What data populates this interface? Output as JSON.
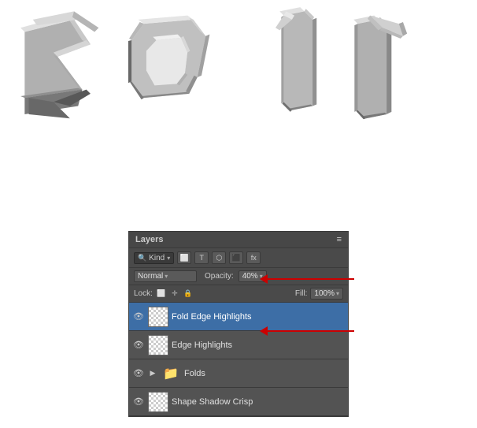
{
  "panel": {
    "title": "Layers",
    "menu_icon": "≡",
    "filter": {
      "kind_label": "Kind",
      "kind_arrow": "▾"
    },
    "blend_mode": {
      "label": "Normal",
      "arrow": "▾"
    },
    "opacity": {
      "label": "Opacity:",
      "value": "40%",
      "arrow": "▾"
    },
    "lock": {
      "label": "Lock:"
    },
    "fill": {
      "label": "Fill:",
      "value": "100%",
      "arrow": "▾"
    },
    "layers": [
      {
        "name": "Fold Edge Highlights",
        "visible": true,
        "selected": true,
        "type": "normal"
      },
      {
        "name": "Edge Highlights",
        "visible": true,
        "selected": false,
        "type": "normal"
      },
      {
        "name": "Folds",
        "visible": true,
        "selected": false,
        "type": "folder"
      },
      {
        "name": "Shape Shadow Crisp",
        "visible": true,
        "selected": false,
        "type": "normal"
      }
    ]
  }
}
